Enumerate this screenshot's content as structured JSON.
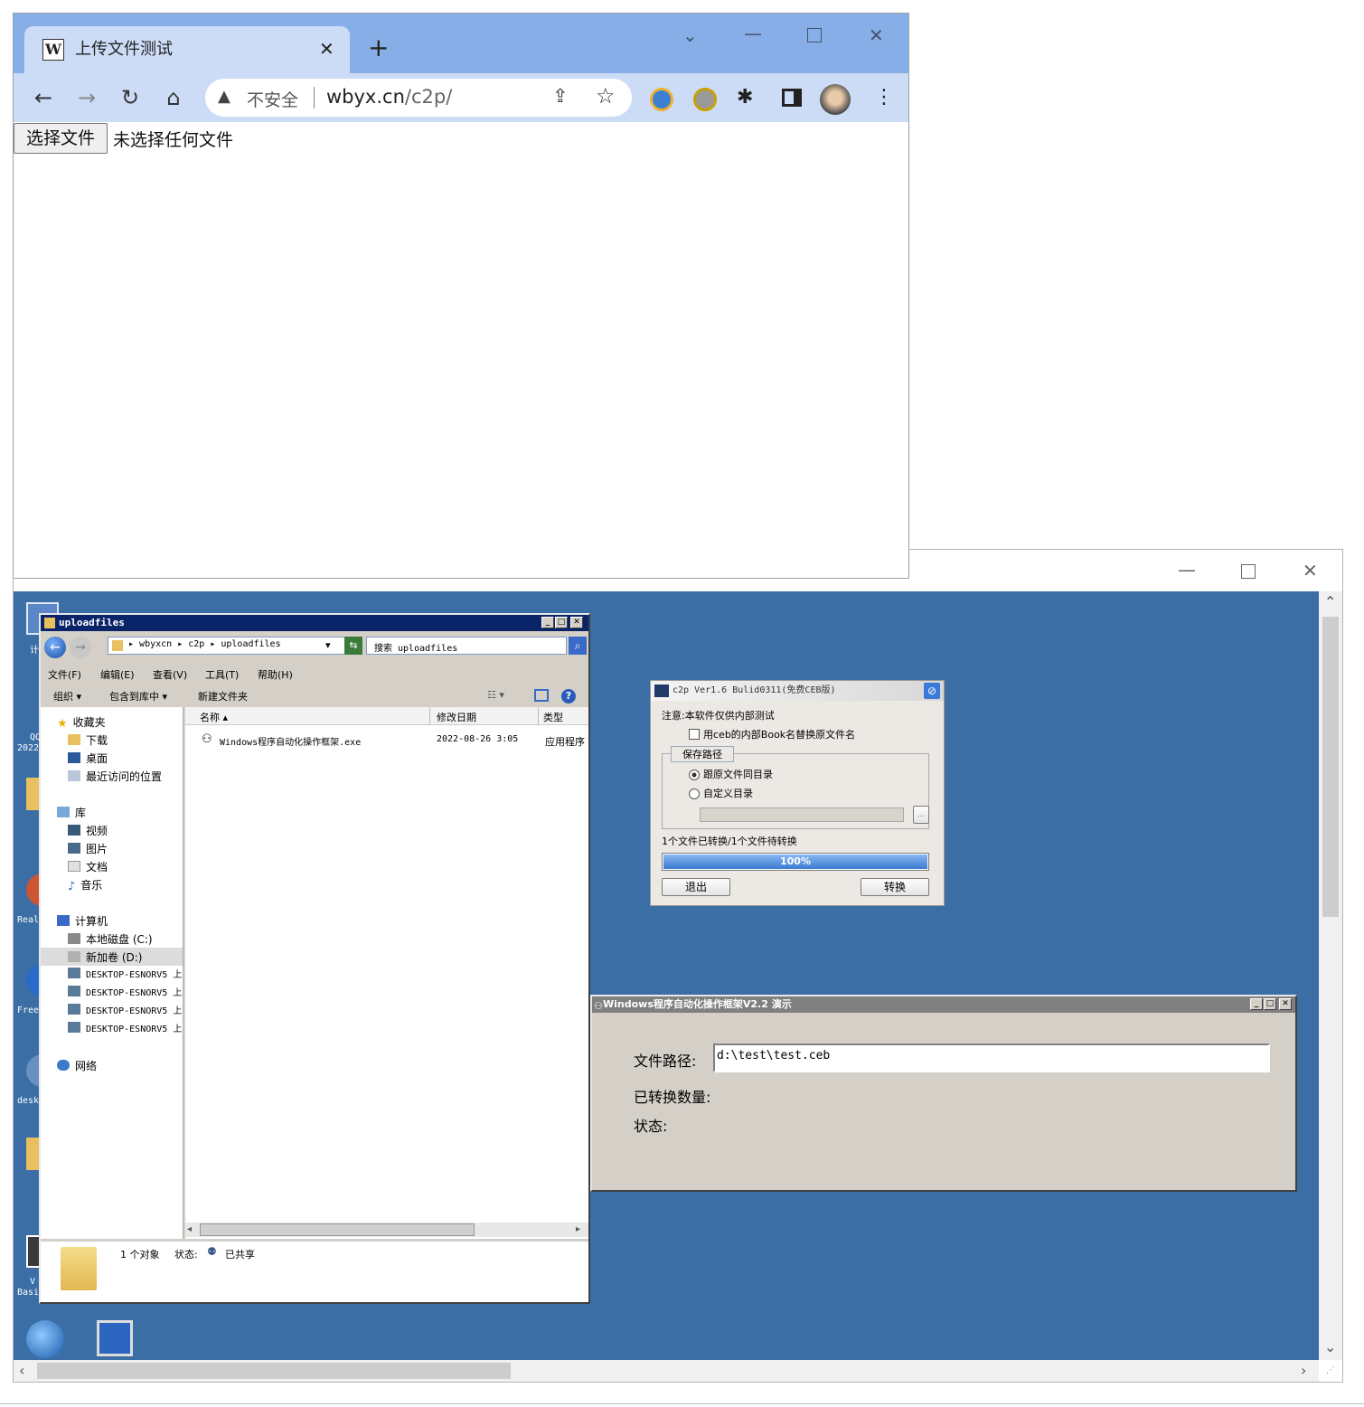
{
  "browser": {
    "tab_title": "上传文件测试",
    "tab_favicon": "W",
    "omnibox_warning": "不安全",
    "url_host": "wbyx.cn",
    "url_path": "/c2p/",
    "page": {
      "file_button_label": "选择文件",
      "no_file_text": "未选择任何文件"
    }
  },
  "explorer": {
    "title": "uploadfiles",
    "breadcrumb": [
      "wbyxcn",
      "c2p",
      "uploadfiles"
    ],
    "search_placeholder": "搜索 uploadfiles",
    "menu": [
      "文件(F)",
      "编辑(E)",
      "查看(V)",
      "工具(T)",
      "帮助(H)"
    ],
    "commands": [
      "组织",
      "包含到库中",
      "新建文件夹"
    ],
    "nav": {
      "favorites": "收藏夹",
      "favorites_items": [
        "下载",
        "桌面",
        "最近访问的位置"
      ],
      "libraries": "库",
      "libraries_items": [
        "视频",
        "图片",
        "文档",
        "音乐"
      ],
      "computer": "计算机",
      "computer_items": [
        "本地磁盘 (C:)",
        "新加卷 (D:)",
        "DESKTOP-ESNORV5 上",
        "DESKTOP-ESNORV5 上",
        "DESKTOP-ESNORV5 上",
        "DESKTOP-ESNORV5 上"
      ],
      "network": "网络"
    },
    "columns": [
      "名称",
      "修改日期",
      "类型"
    ],
    "files": [
      {
        "name": "Windows程序自动化操作框架.exe",
        "date": "2022-08-26 3:05",
        "type": "应用程序"
      }
    ],
    "status_count": "1 个对象",
    "status_label": "状态:",
    "status_value": "已共享"
  },
  "c2p": {
    "title": "c2p   Ver1.6 Bulid0311(免费CEB版)",
    "notice": "注意:本软件仅供内部测试",
    "checkbox_label": "用ceb的内部Book名替换原文件名",
    "group_label": "保存路径",
    "radio_same": "跟原文件同目录",
    "radio_custom": "自定义目录",
    "browse_label": "...",
    "progress_text": "1个文件已转换/1个文件待转换",
    "progress_percent": "100%",
    "progress_value": 1.0,
    "exit_button": "退出",
    "convert_button": "转换"
  },
  "demo": {
    "title": "Windows程序自动化操作框架V2.2 演示",
    "path_label": "文件路径:",
    "path_value": "d:\\test\\test.ceb",
    "count_label": "已转换数量:",
    "status_label": "状态:"
  },
  "desktop_labels": [
    "计",
    "QQ",
    "2022",
    "Real",
    "Free",
    "desk",
    "V",
    "Basi"
  ],
  "colors": {
    "desktop": "#3a6ea5",
    "chrome_tabstrip": "#88aee8",
    "chrome_toolbar": "#cddcf6",
    "progress": "#4a8ad8"
  }
}
